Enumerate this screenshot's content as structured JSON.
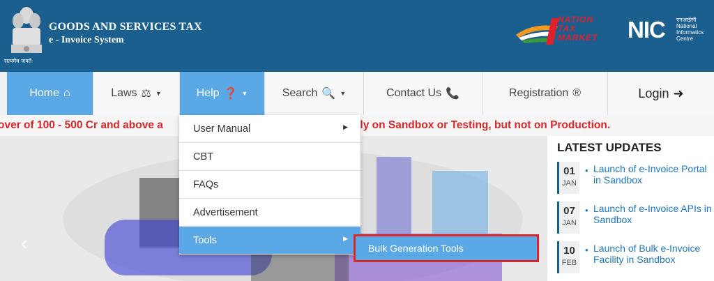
{
  "header": {
    "title": "GOODS AND SERVICES TAX",
    "subtitle": "e - Invoice System",
    "emblem_caption": "सत्यमेव जयते",
    "ntm_logo_text": [
      "NATION",
      "TAX",
      "MARKET"
    ],
    "nic_logo": {
      "big": "NIC",
      "small": [
        "एनआईसी",
        "National",
        "Informatics",
        "Centre"
      ]
    }
  },
  "nav": {
    "items": [
      {
        "label": "Home",
        "icon": "home-icon"
      },
      {
        "label": "Laws",
        "icon": "briefcase-icon"
      },
      {
        "label": "Help",
        "icon": "question-icon"
      },
      {
        "label": "Search",
        "icon": "search-icon"
      },
      {
        "label": "Contact Us",
        "icon": "phone-icon"
      },
      {
        "label": "Registration",
        "icon": "registered-icon"
      },
      {
        "label": "Login",
        "icon": "sign-in-icon"
      }
    ]
  },
  "marquee": {
    "text": "over of 100 - 500 Cr and above a                                                       em only on Sandbox or Testing, but not on Production."
  },
  "help_menu": {
    "items": [
      "User Manual",
      "CBT",
      "FAQs",
      "Advertisement",
      "Tools"
    ],
    "selected": "Tools",
    "submenu_item": "Bulk Generation Tools"
  },
  "latest_updates": {
    "title": "LATEST UPDATES",
    "items": [
      {
        "day": "01",
        "month": "JAN",
        "text": "Launch of e-Invoice Portal in Sandbox"
      },
      {
        "day": "07",
        "month": "JAN",
        "text": "Launch of e-Invoice APIs in Sandbox"
      },
      {
        "day": "10",
        "month": "FEB",
        "text": "Launch of Bulk e-Invoice Facility in Sandbox"
      }
    ]
  },
  "colors": {
    "header": "#1b5f8f",
    "accent": "#5aa9e6",
    "alert": "#d9262b",
    "link": "#1b78c2"
  }
}
